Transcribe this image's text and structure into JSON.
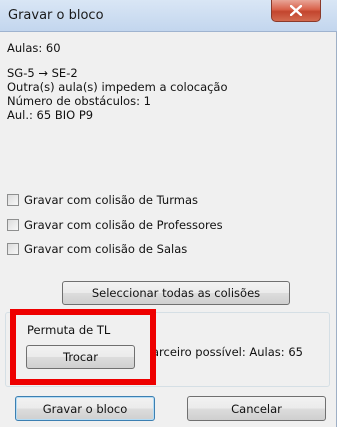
{
  "window": {
    "title": "Gravar o bloco"
  },
  "info": {
    "aulas": "Aulas: 60",
    "move": "SG-5 → SE-2",
    "impedem": "Outra(s) aula(s) impedem a colocação",
    "obstaculos": "Número de obstáculos: 1",
    "aul": "Aul.: 65 BIO P9"
  },
  "options": [
    {
      "label": "Gravar com colisão de Turmas",
      "checked": false
    },
    {
      "label": "Gravar com colisão de Professores",
      "checked": false
    },
    {
      "label": "Gravar com colisão de Salas",
      "checked": false
    }
  ],
  "select_all_label": "Seleccionar todas as colisões",
  "permuta": {
    "heading": "Permuta de TL",
    "trocar_label": "Trocar",
    "parceiro": "arceiro possível: Aulas: 65"
  },
  "footer": {
    "gravar_label": "Gravar o bloco",
    "cancelar_label": "Cancelar"
  },
  "colors": {
    "highlight": "#ee0000",
    "close_button": "#c2452e"
  }
}
